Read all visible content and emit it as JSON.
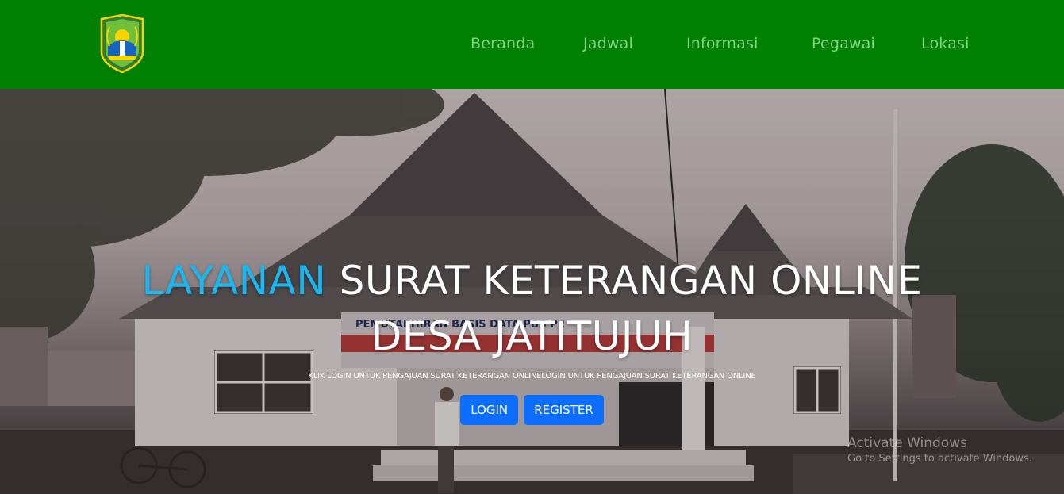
{
  "header": {
    "logo_icon": "regency-crest-icon",
    "nav": [
      {
        "label": "Beranda"
      },
      {
        "label": "Jadwal"
      },
      {
        "label": "Informasi"
      },
      {
        "label": "Pegawai"
      },
      {
        "label": "Lokasi"
      }
    ]
  },
  "hero": {
    "title_accent": "LAYANAN",
    "title_rest": " SURAT KETERANGAN ONLINE",
    "title_line2": "DESA JATITUJUH",
    "subtitle": "KLIK LOGIN UNTUK PENGAJUAN SURAT KETERANGAN ONLINELOGIN UNTUK PENGAJUAN SURAT KETERANGAN ONLINE",
    "login_label": "LOGIN",
    "register_label": "REGISTER",
    "banner_text": "PEMUTAKHIRAN BASIS DATA PBB P2"
  },
  "watermark": {
    "line1": "Activate Windows",
    "line2": "Go to Settings to activate Windows."
  },
  "colors": {
    "header_bg": "#008000",
    "nav_text": "#7fd27f",
    "accent": "#1ab6f0",
    "button": "#0d6efd"
  }
}
